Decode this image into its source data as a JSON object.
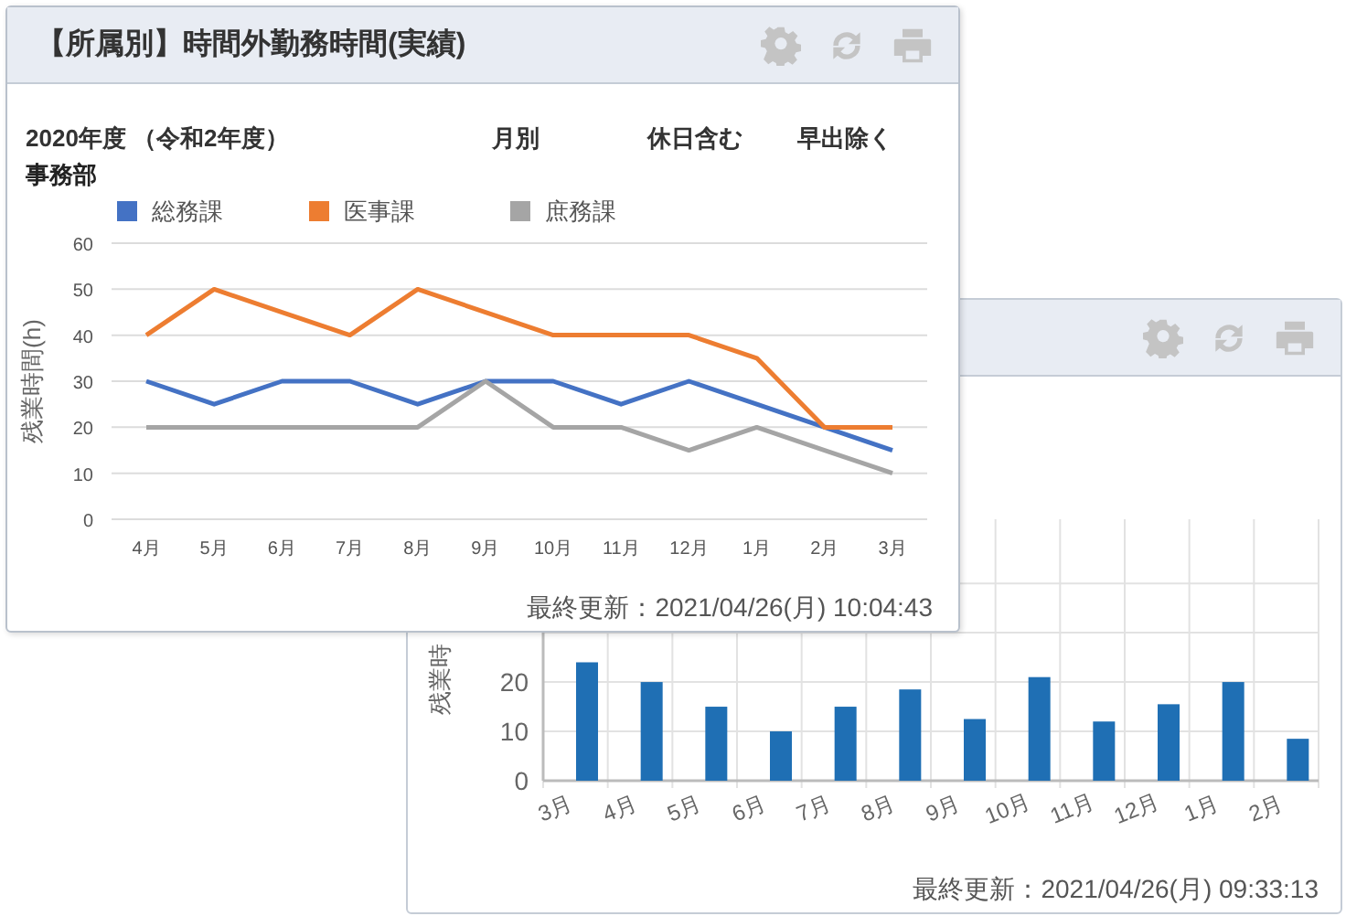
{
  "front_panel": {
    "title": "【所属別】時間外勤務時間(実績)",
    "info": [
      "2020年度 （令和2年度）",
      "月別",
      "休日含む",
      "早出除く"
    ],
    "department": "事務部",
    "chart_data": {
      "type": "line",
      "grid": true,
      "legend": true,
      "ylabel": "残業時間(h)",
      "categories": [
        "4月",
        "5月",
        "6月",
        "7月",
        "8月",
        "9月",
        "10月",
        "11月",
        "12月",
        "1月",
        "2月",
        "3月"
      ],
      "ylim": [
        0,
        60
      ],
      "yticks": [
        0,
        10,
        20,
        30,
        40,
        50,
        60
      ],
      "series": [
        {
          "name": "総務課",
          "color": "#4472c4",
          "values": [
            30,
            25,
            30,
            30,
            25,
            30,
            30,
            25,
            30,
            25,
            20,
            15
          ]
        },
        {
          "name": "医事課",
          "color": "#ed7d31",
          "values": [
            40,
            50,
            45,
            40,
            50,
            45,
            40,
            40,
            40,
            35,
            20,
            20
          ]
        },
        {
          "name": "庶務課",
          "color": "#a5a5a5",
          "values": [
            20,
            20,
            20,
            20,
            20,
            30,
            20,
            20,
            15,
            20,
            15,
            10
          ]
        }
      ]
    },
    "updated": "最終更新：2021/04/26(月) 10:04:43"
  },
  "back_panel": {
    "chart_data": {
      "type": "bar",
      "grid": true,
      "ylabel": "残業時",
      "categories": [
        "3月",
        "4月",
        "5月",
        "6月",
        "7月",
        "8月",
        "9月",
        "10月",
        "11月",
        "12月",
        "1月",
        "2月"
      ],
      "ylim": [
        0,
        53
      ],
      "yticks": [
        0,
        10,
        20
      ],
      "series": [
        {
          "color": "#1f6fb4",
          "values": [
            24,
            20,
            15,
            10,
            15,
            18.5,
            12.5,
            21,
            12,
            15.5,
            20,
            8.5
          ]
        }
      ]
    },
    "updated": "最終更新：2021/04/26(月) 09:33:13"
  }
}
